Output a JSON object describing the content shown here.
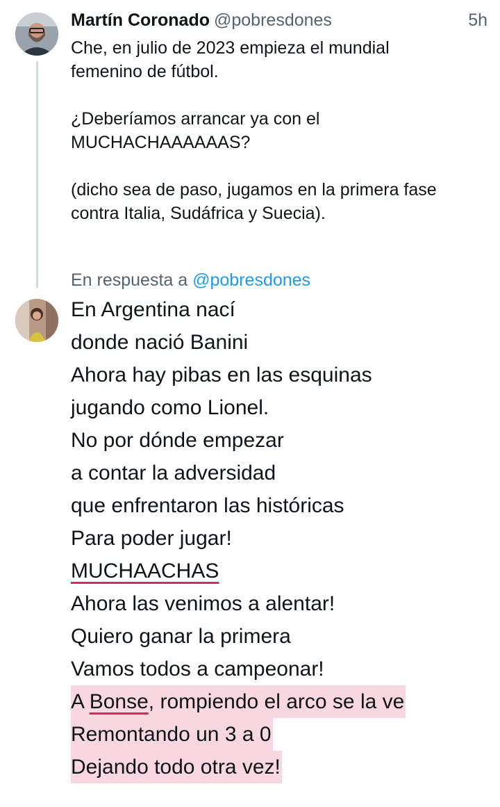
{
  "tweet": {
    "author_name": "Martín Coronado",
    "author_handle": "@pobresdones",
    "time": "5h",
    "lines": [
      "Che, en julio de 2023 empieza el mundial",
      "femenino de fútbol.",
      "¿Deberíamos arrancar ya con el",
      "MUCHACHAAAAAAS?",
      "(dicho sea de paso, jugamos en la primera fase",
      "contra Italia, Sudáfrica y Suecia)."
    ]
  },
  "reply": {
    "replying_label": "En respuesta a",
    "replying_handle": "@pobresdones",
    "lines": [
      "En Argentina nací",
      "donde nació Banini",
      "Ahora hay pibas en las esquinas",
      "jugando como Lionel.",
      "No por dónde empezar",
      "a contar la adversidad",
      "que enfrentaron las históricas",
      "Para poder jugar!",
      "MUCHAACHAS",
      "Ahora las venimos a alentar!",
      "Quiero ganar la primera",
      "Vamos todos a campeonar!"
    ],
    "hl_line1_a": "A ",
    "hl_line1_word": "Bonse",
    "hl_line1_b": ", rompiendo el arco se la ve",
    "hl_line2": "Remontando un 3 a 0",
    "hl_line3": "Dejando todo otra vez!"
  },
  "colors": {
    "handle": "#536471",
    "mention": "#1d9bf0",
    "spell_underline": "#e0245e",
    "highlight": "#f8d7e1",
    "thread_line": "#cfd9de"
  }
}
